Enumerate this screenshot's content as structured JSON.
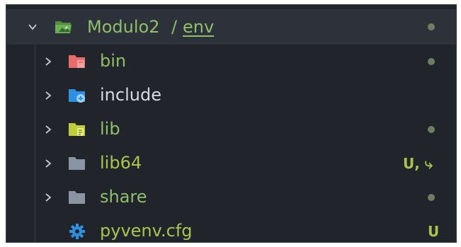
{
  "colors": {
    "background": "#21252b",
    "root_highlight": "#2c313a",
    "modified_green": "#8fbf6a",
    "untracked_green": "#a9c34f",
    "neutral_text": "#d7dae0",
    "dot_gray": "#6f7f5e"
  },
  "root": {
    "folder_name": "Modulo2",
    "separator": "/",
    "subfolder_name": "env",
    "chevron_icon": "chevron-down-icon",
    "folder_icon": "folder-open-icon"
  },
  "items": [
    {
      "label": "bin",
      "icon": "folder-bin-icon",
      "icon_color": "#e66b6b",
      "label_color": "#8fbf6a",
      "status": "",
      "has_dot": true,
      "chevron": true
    },
    {
      "label": "include",
      "icon": "folder-include-icon",
      "icon_color": "#2f8fe0",
      "label_color": "#d7dae0",
      "status": "",
      "has_dot": false,
      "chevron": true
    },
    {
      "label": "lib",
      "icon": "folder-lib-icon",
      "icon_color": "#c0cc3a",
      "label_color": "#8fbf6a",
      "status": "",
      "has_dot": true,
      "chevron": true
    },
    {
      "label": "lib64",
      "icon": "folder-icon",
      "icon_color": "#8a94a3",
      "label_color": "#a9c34f",
      "status": "U, ⤷",
      "has_dot": false,
      "chevron": true
    },
    {
      "label": "share",
      "icon": "folder-icon",
      "icon_color": "#8a94a3",
      "label_color": "#8fbf6a",
      "status": "",
      "has_dot": true,
      "chevron": true
    },
    {
      "label": "pyvenv.cfg",
      "icon": "gear-icon",
      "icon_color": "#2f8fe0",
      "label_color": "#a9c34f",
      "status": "U",
      "has_dot": false,
      "chevron": false
    }
  ]
}
